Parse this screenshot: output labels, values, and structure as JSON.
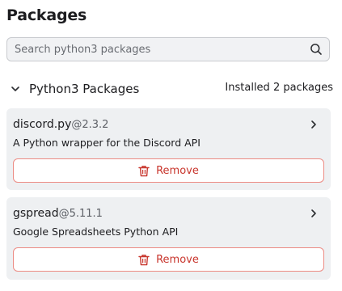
{
  "header": {
    "title": "Packages"
  },
  "search": {
    "placeholder": "Search python3 packages",
    "icon": "search-icon"
  },
  "section": {
    "label": "Python3 Packages",
    "installed_count": "Installed 2 packages",
    "icon": "chevron-down-icon"
  },
  "packages": [
    {
      "name": "discord.py",
      "version": "@2.3.2",
      "description": "A Python wrapper for the Discord API",
      "remove_label": "Remove"
    },
    {
      "name": "gspread",
      "version": "@5.11.1",
      "description": "Google Spreadsheets Python API",
      "remove_label": "Remove"
    }
  ],
  "colors": {
    "danger": "#c8352c",
    "danger_border": "#ec8b84",
    "card_bg": "#eef0f2"
  }
}
